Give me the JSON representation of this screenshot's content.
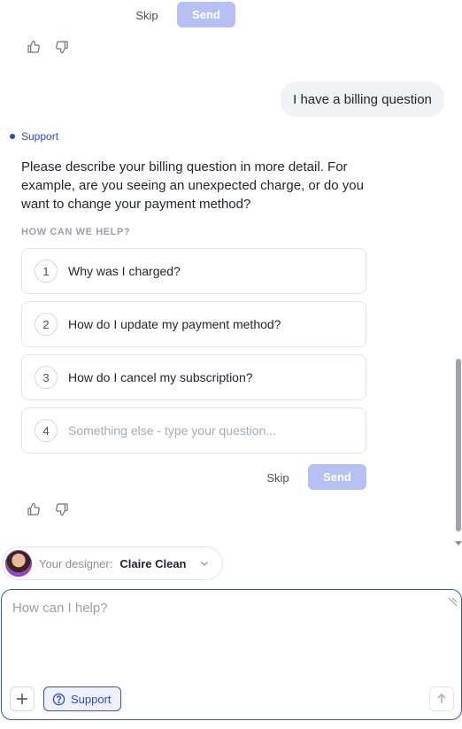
{
  "previous_turn": {
    "skip_label": "Skip",
    "send_label": "Send"
  },
  "user_message": "I have a billing question",
  "assistant": {
    "tag": "Support",
    "message": "Please describe your billing question in more detail. For example, are you seeing an unexpected charge, or do you want to change your payment method?",
    "section_label": "HOW CAN WE HELP?",
    "options": [
      {
        "number": "1",
        "label": "Why was I charged?"
      },
      {
        "number": "2",
        "label": "How do I update my payment method?"
      },
      {
        "number": "3",
        "label": "How do I cancel my subscription?"
      },
      {
        "number": "4",
        "placeholder": "Something else - type your question..."
      }
    ],
    "skip_label": "Skip",
    "send_label": "Send"
  },
  "designer": {
    "prefix": "Your designer:",
    "name": "Claire Clean"
  },
  "composer": {
    "placeholder": "How can I help?",
    "mode_label": "Support"
  },
  "colors": {
    "accent": "#3552c6",
    "send_disabled": "#b7c0f2",
    "bubble": "#f1f2f4"
  }
}
